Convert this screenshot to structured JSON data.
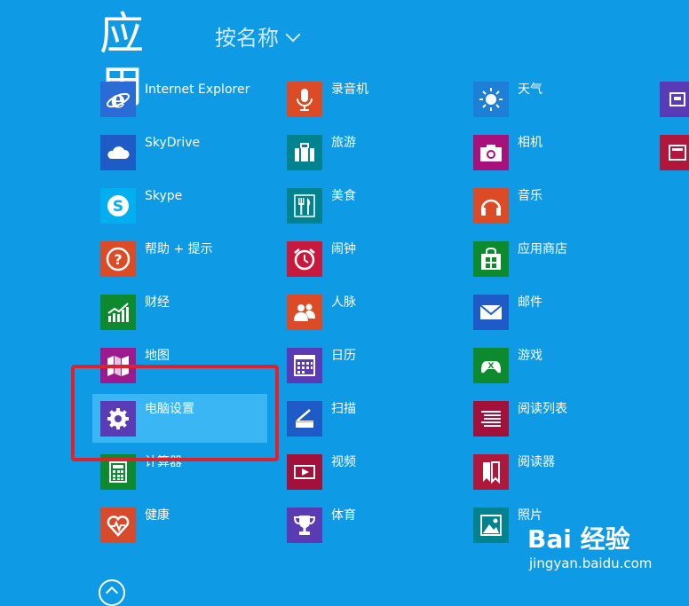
{
  "header": {
    "title": "应用",
    "sort_label": "按名称"
  },
  "colors": {
    "background": "#0f9ae6",
    "selection": "#3ab6f4",
    "highlight_box": "#e0202a"
  },
  "apps": {
    "internet_explorer": {
      "label": "Internet Explorer",
      "icon": "ie-icon",
      "color": "#2b6bd6"
    },
    "skydrive": {
      "label": "SkyDrive",
      "icon": "cloud-icon",
      "color": "#1e5bc6"
    },
    "skype": {
      "label": "Skype",
      "icon": "skype-icon",
      "color": "#00aff0"
    },
    "help": {
      "label": "帮助 + 提示",
      "icon": "question-icon",
      "color": "#dc4a26"
    },
    "finance": {
      "label": "财经",
      "icon": "finance-chart-icon",
      "color": "#0c8a2d"
    },
    "maps": {
      "label": "地图",
      "icon": "map-icon",
      "color": "#9c1a8e"
    },
    "pc_settings": {
      "label": "电脑设置",
      "icon": "gear-icon",
      "color": "#5a3ab5"
    },
    "calculator": {
      "label": "计算器",
      "icon": "calculator-icon",
      "color": "#0c8a2d"
    },
    "health": {
      "label": "健康",
      "icon": "heart-icon",
      "color": "#d84a2c"
    },
    "recorder": {
      "label": "录音机",
      "icon": "microphone-icon",
      "color": "#dc4a26"
    },
    "travel": {
      "label": "旅游",
      "icon": "suitcase-icon",
      "color": "#00838f"
    },
    "food": {
      "label": "美食",
      "icon": "fork-knife-icon",
      "color": "#00838f"
    },
    "alarms": {
      "label": "闹钟",
      "icon": "alarm-clock-icon",
      "color": "#c8193c"
    },
    "people": {
      "label": "人脉",
      "icon": "people-icon",
      "color": "#dc4a26"
    },
    "calendar": {
      "label": "日历",
      "icon": "calendar-icon",
      "color": "#5a3ab5"
    },
    "scan": {
      "label": "扫描",
      "icon": "scanner-icon",
      "color": "#1e5bc6"
    },
    "video": {
      "label": "视频",
      "icon": "video-icon",
      "color": "#a3103a"
    },
    "sports": {
      "label": "体育",
      "icon": "trophy-icon",
      "color": "#5a3ab5"
    },
    "weather": {
      "label": "天气",
      "icon": "sun-icon",
      "color": "#1e7fd6"
    },
    "camera": {
      "label": "相机",
      "icon": "camera-icon",
      "color": "#a8117c"
    },
    "music": {
      "label": "音乐",
      "icon": "headphones-icon",
      "color": "#dc4a26"
    },
    "store": {
      "label": "应用商店",
      "icon": "store-bag-icon",
      "color": "#0c8a2d"
    },
    "mail": {
      "label": "邮件",
      "icon": "mail-icon",
      "color": "#1e5bc6"
    },
    "games": {
      "label": "游戏",
      "icon": "gamepad-icon",
      "color": "#0c8a2d"
    },
    "reading_list": {
      "label": "阅读列表",
      "icon": "reading-list-icon",
      "color": "#a3103a"
    },
    "reader": {
      "label": "阅读器",
      "icon": "reader-icon",
      "color": "#b0173a"
    },
    "photos": {
      "label": "照片",
      "icon": "photo-icon",
      "color": "#00838f"
    },
    "extra_1": {
      "icon": "window-icon",
      "color": "#5a3ab5"
    },
    "extra_2": {
      "icon": "news-icon",
      "color": "#b0173a"
    }
  },
  "watermark": {
    "brand": "Bai 经验",
    "url": "jingyan.baidu.com"
  }
}
